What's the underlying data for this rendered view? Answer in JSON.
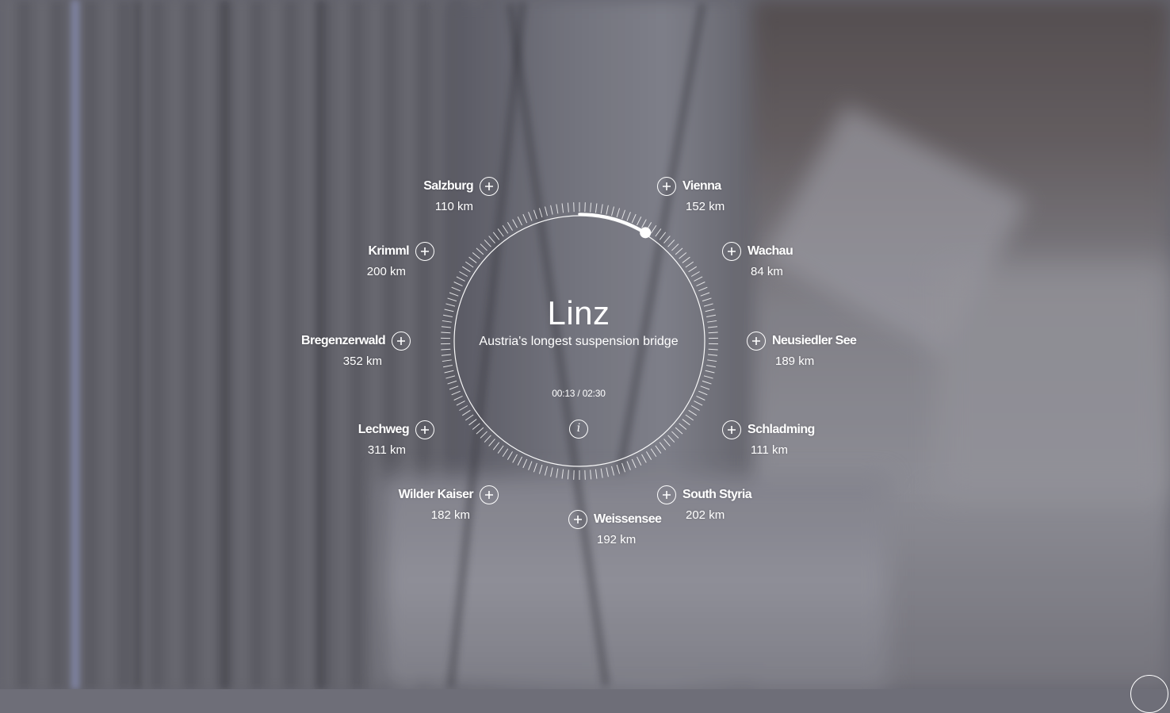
{
  "current": {
    "city": "Linz",
    "description": "Austria's longest suspension bridge",
    "time_elapsed": "00:13",
    "time_separator": "/",
    "time_total": "02:30",
    "progress": 0.087
  },
  "icons": {
    "info": "info-icon",
    "plus": "plus-icon"
  },
  "destinations": [
    {
      "name": "Salzburg",
      "distance": "110 km"
    },
    {
      "name": "Vienna",
      "distance": "152 km"
    },
    {
      "name": "Krimml",
      "distance": "200 km"
    },
    {
      "name": "Wachau",
      "distance": "84 km"
    },
    {
      "name": "Bregenzerwald",
      "distance": "352 km"
    },
    {
      "name": "Neusiedler See",
      "distance": "189 km"
    },
    {
      "name": "Lechweg",
      "distance": "311 km"
    },
    {
      "name": "Schladming",
      "distance": "111 km"
    },
    {
      "name": "Wilder Kaiser",
      "distance": "182 km"
    },
    {
      "name": "South Styria",
      "distance": "202 km"
    },
    {
      "name": "Weissensee",
      "distance": "192 km"
    }
  ],
  "colors": {
    "ring": "#ffffff",
    "background": "#6e6e78"
  }
}
